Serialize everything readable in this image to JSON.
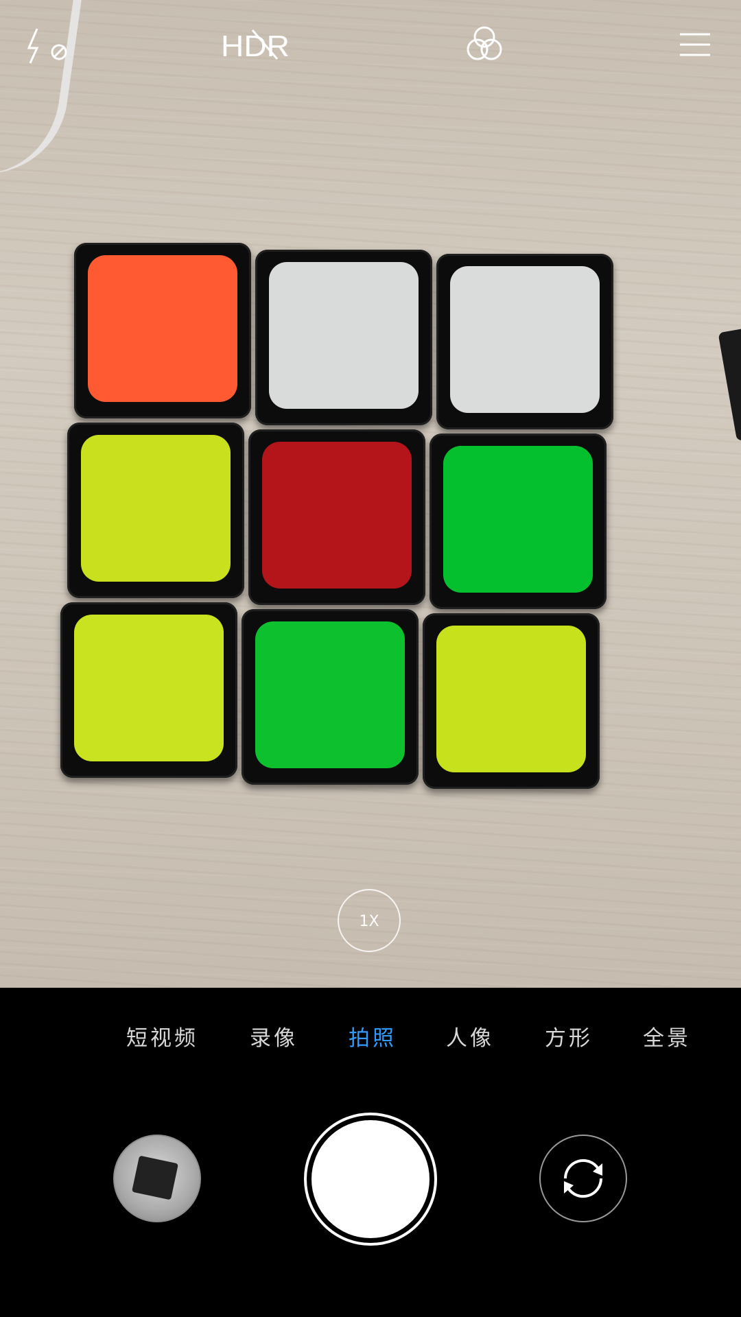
{
  "top_bar": {
    "flash_icon": "flash-off-icon",
    "hdr_label": "HDR",
    "filter_icon": "filter-circles-icon",
    "menu_icon": "menu-icon"
  },
  "zoom": {
    "label": "1X"
  },
  "modes": {
    "items": [
      {
        "label": "短视频"
      },
      {
        "label": "录像"
      },
      {
        "label": "拍照"
      },
      {
        "label": "人像"
      },
      {
        "label": "方形"
      },
      {
        "label": "全景"
      }
    ],
    "active": "拍照",
    "active_color": "#2f9bff"
  },
  "controls": {
    "gallery_icon": "gallery-thumbnail",
    "shutter_icon": "shutter-button",
    "switch_icon": "camera-switch-icon"
  },
  "viewfinder": {
    "cube_colors": [
      [
        "#ff5a32",
        "#d9dbdb",
        "#dadcdc"
      ],
      [
        "#c8e01e",
        "#b3151a",
        "#05c02e"
      ],
      [
        "#c9e320",
        "#0dc12e",
        "#c8e11d"
      ]
    ]
  }
}
